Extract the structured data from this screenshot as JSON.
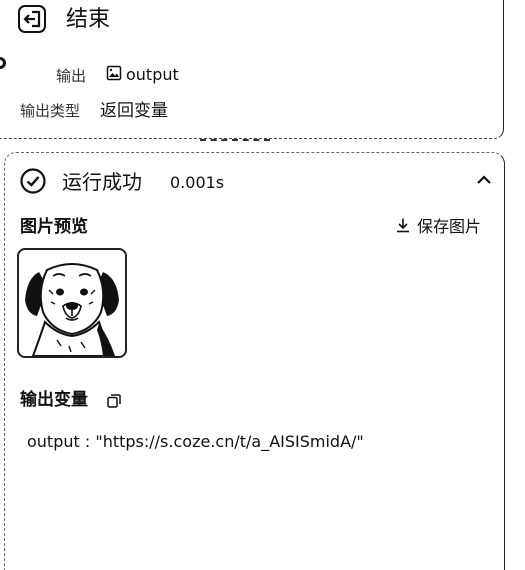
{
  "end_node": {
    "title": "结束",
    "output_label": "输出",
    "output_value": "output",
    "output_type_label": "输出类型",
    "output_type_value": "返回变量"
  },
  "result": {
    "status": "运行成功",
    "duration": "0.001s",
    "preview_label": "图片预览",
    "save_label": "保存图片",
    "vars_label": "输出变量",
    "output_key": "output",
    "output_sep": " : ",
    "output_value": "\"https://s.coze.cn/t/a_AISISmidA/\""
  },
  "icons": {
    "end": "exit-node-icon",
    "image": "image-icon",
    "success": "check-circle-icon",
    "collapse": "chevron-up-icon",
    "download": "download-icon",
    "copy": "copy-icon"
  }
}
